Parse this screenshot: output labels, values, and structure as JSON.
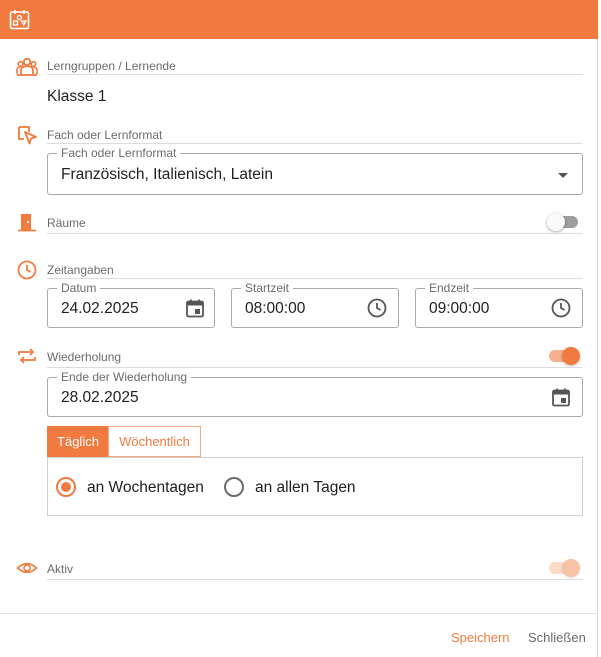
{
  "colors": {
    "accent": "#f07a3f",
    "accent_light": "#f6b08d",
    "text": "#212121",
    "muted": "#6b6b6b"
  },
  "header": {
    "logo_icon": "calendar-shapes-icon"
  },
  "groups": {
    "label": "Lerngruppen / Lernende",
    "value": "Klasse 1",
    "icon": "group-icon"
  },
  "subject": {
    "label": "Fach oder Lernformat",
    "icon": "subject-pointer-icon",
    "select": {
      "label": "Fach oder Lernformat",
      "value": "Französisch, Italienisch, Latein"
    }
  },
  "rooms": {
    "label": "Räume",
    "icon": "door-icon",
    "toggle_on": false
  },
  "time": {
    "label": "Zeitangaben",
    "icon": "clock-icon",
    "date": {
      "label": "Datum",
      "value": "24.02.2025"
    },
    "start": {
      "label": "Startzeit",
      "value": "08:00:00"
    },
    "end": {
      "label": "Endzeit",
      "value": "09:00:00"
    }
  },
  "repeat": {
    "label": "Wiederholung",
    "icon": "repeat-icon",
    "toggle_on": true,
    "end": {
      "label": "Ende der Wiederholung",
      "value": "28.02.2025"
    },
    "tabs": [
      {
        "label": "Täglich",
        "active": true
      },
      {
        "label": "Wöchentlich",
        "active": false
      }
    ],
    "options": [
      {
        "label": "an Wochentagen",
        "checked": true
      },
      {
        "label": "an allen Tagen",
        "checked": false
      }
    ]
  },
  "active": {
    "label": "Aktiv",
    "icon": "eye-icon",
    "toggle_on": true,
    "disabled": true
  },
  "footer": {
    "save_label": "Speichern",
    "close_label": "Schließen"
  }
}
